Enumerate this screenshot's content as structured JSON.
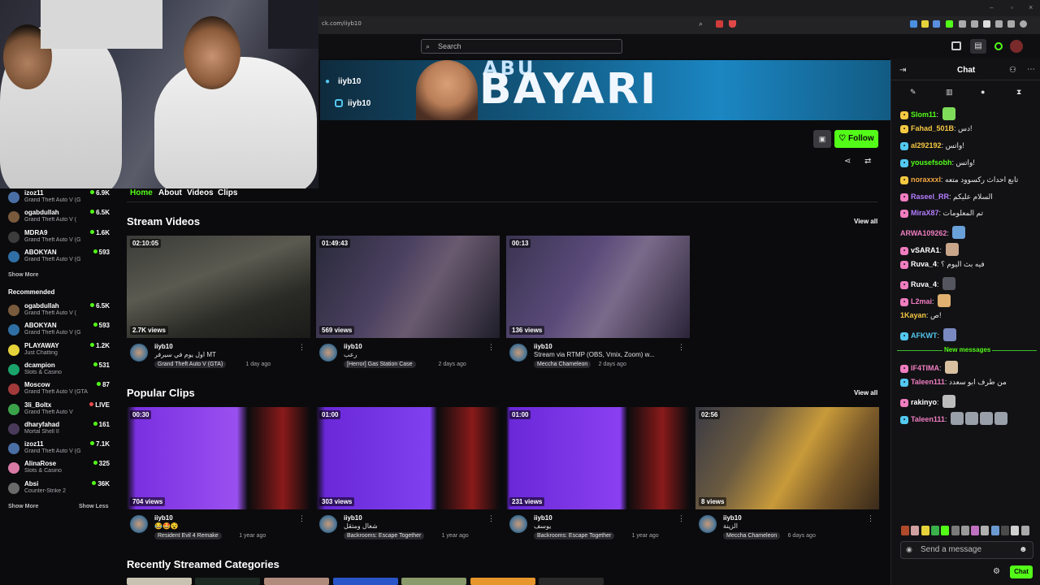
{
  "browser": {
    "url": "ck.com/iiyb10"
  },
  "search": {
    "placeholder": "Search"
  },
  "banner": {
    "top_text": "ABU",
    "title": "BAYARI",
    "social1": "iiyb10",
    "social2": "iiyb10"
  },
  "channel": {
    "follow_label": "Follow"
  },
  "sidebar": {
    "following": [
      {
        "name": "izoz11",
        "category": "Grand Theft Auto V (G",
        "count": "6.9K",
        "color": "#4a6fa5"
      },
      {
        "name": "ogabdullah",
        "category": "Grand Theft Auto V (",
        "count": "6.5K",
        "color": "#7a5a3c"
      },
      {
        "name": "MDRA9",
        "category": "Grand Theft Auto V (G",
        "count": "1.6K",
        "color": "#3c3c3c"
      },
      {
        "name": "ABOKYAN",
        "category": "Grand Theft Auto V (G",
        "count": "593",
        "color": "#2f6fa5"
      }
    ],
    "show_more": "Show More",
    "recommended_label": "Recommended",
    "recommended": [
      {
        "name": "ogabdullah",
        "category": "Grand Theft Auto V (",
        "count": "6.5K",
        "color": "#7a5a3c"
      },
      {
        "name": "ABOKYAN",
        "category": "Grand Theft Auto V (G",
        "count": "593",
        "color": "#2f6fa5"
      },
      {
        "name": "PLAYAWAY",
        "category": "Just Chatting",
        "count": "1.2K",
        "color": "#e6d23a"
      },
      {
        "name": "dcampion",
        "category": "Slots & Casino",
        "count": "531",
        "color": "#1aa36a"
      },
      {
        "name": "Moscow",
        "category": "Grand Theft Auto V (GTA)",
        "count": "87",
        "color": "#a33a3a"
      },
      {
        "name": "3li_Boltx",
        "category": "Grand Theft Auto V",
        "count": "LIVE",
        "color": "#3aa34a"
      },
      {
        "name": "dharyfahad",
        "category": "Mortal Shell II",
        "count": "161",
        "color": "#4a3a5a"
      },
      {
        "name": "izoz11",
        "category": "Grand Theft Auto V (G",
        "count": "7.1K",
        "color": "#4a6fa5"
      },
      {
        "name": "AlinaRose",
        "category": "Slots & Casino",
        "count": "325",
        "color": "#d97aa5"
      },
      {
        "name": "Absi",
        "category": "Counter-Strike 2",
        "count": "36K",
        "color": "#6a6a6a"
      }
    ],
    "show_more2": "Show More",
    "show_less": "Show Less"
  },
  "tabs": [
    "Home",
    "About",
    "Videos",
    "Clips"
  ],
  "stream_videos": {
    "title": "Stream Videos",
    "view_all": "View all",
    "items": [
      {
        "duration": "02:10:05",
        "views": "2.7K views",
        "channel": "iiyb10",
        "title": "اول يوم في سيرفر MT",
        "category": "Grand Theft Auto V (GTA)",
        "age": "1 day ago"
      },
      {
        "duration": "01:49:43",
        "views": "569 views",
        "channel": "iiyb10",
        "title": "رعب",
        "category": "[Herror] Gas Station Case",
        "age": "2 days ago"
      },
      {
        "duration": "00:13",
        "views": "136 views",
        "channel": "iiyb10",
        "title": "Stream via RTMP (OBS, Vmix, Zoom) w...",
        "category": "Meccha Chameleon",
        "age": "2 days ago"
      }
    ]
  },
  "popular_clips": {
    "title": "Popular Clips",
    "view_all": "View all",
    "items": [
      {
        "duration": "00:30",
        "views": "704 views",
        "channel": "iiyb10",
        "title": "😂🤩😵",
        "category": "Resident Evil 4 Remake",
        "age": "1 year ago"
      },
      {
        "duration": "01:00",
        "views": "303 views",
        "channel": "iiyb10",
        "title": "شغال ومتقل",
        "category": "Backrooms: Escape Together",
        "age": "1 year ago"
      },
      {
        "duration": "01:00",
        "views": "231 views",
        "channel": "iiyb10",
        "title": "يوسف",
        "category": "Backrooms: Escape Together",
        "age": "1 year ago"
      },
      {
        "duration": "02:56",
        "views": "8 views",
        "channel": "iiyb10",
        "title": "الزينة",
        "category": "Meccha Chameleon",
        "age": "6 days ago"
      }
    ]
  },
  "recent_categories": {
    "title": "Recently Streamed Categories"
  },
  "chat": {
    "title": "Chat",
    "new_messages": "New messages",
    "input_placeholder": "Send a message",
    "send_label": "Chat",
    "messages": [
      {
        "user": "Slom11",
        "text": "",
        "color": "#53fc18",
        "badge": "#f5c842",
        "emote": "#7fdc5a"
      },
      {
        "user": "Fahad_501B",
        "text": "دس!",
        "color": "#f5c842",
        "badge": "#f5c842",
        "emote": ""
      },
      {
        "user": "al292192",
        "text": "واتس!",
        "color": "#f5c842",
        "badge": "#53c8f0",
        "emote": ""
      },
      {
        "user": "yousefsobh",
        "text": "واتس!",
        "color": "#53fc18",
        "badge": "#53c8f0",
        "emote": ""
      },
      {
        "user": "noraxxxl",
        "text": "تابع احداث ركسوود متعه",
        "color": "#f5a742",
        "badge": "#f5c842",
        "emote": ""
      },
      {
        "user": "Raseel_RR",
        "text": "السلام عليكم",
        "color": "#b47dff",
        "badge": "#f07dc0",
        "emote": ""
      },
      {
        "user": "MiraX87",
        "text": "تم المعلومات",
        "color": "#b47dff",
        "badge": "#f07dc0",
        "emote": ""
      },
      {
        "user": "ARWA109262",
        "text": "",
        "color": "#f07dc0",
        "badge": "",
        "emote": "#6aa0d8"
      },
      {
        "user": "vSARA1",
        "text": "",
        "color": "#ffffff",
        "badge": "#f07dc0",
        "emote": "#c9a58a"
      },
      {
        "user": "Ruva_4",
        "text": "فيه بث اليوم ؟",
        "color": "#ffffff",
        "badge": "#f07dc0",
        "emote": ""
      },
      {
        "user": "Ruva_4",
        "text": "",
        "color": "#ffffff",
        "badge": "#f07dc0",
        "emote": "#555560"
      },
      {
        "user": "L2mai",
        "text": "",
        "color": "#f07dc0",
        "badge": "#f07dc0",
        "emote": "#e0b070"
      },
      {
        "user": "1Kayan",
        "text": "ص!",
        "color": "#f5c842",
        "badge": "",
        "emote": ""
      },
      {
        "user": "AFKWT",
        "text": "",
        "color": "#53c8f0",
        "badge": "#53c8f0",
        "emote": "#7a8ac0"
      },
      {
        "user": "IF4TIMA",
        "text": "",
        "color": "#f07dc0",
        "badge": "#f07dc0",
        "emote": "#d8c0a0"
      },
      {
        "user": "Taleen111",
        "text": "من طرف ابو سعدد",
        "color": "#f07dc0",
        "badge": "#53c8f0",
        "emote": ""
      },
      {
        "user": "rakinyo",
        "text": "",
        "color": "#ffffff",
        "badge": "#f07dc0",
        "emote": "#bcbcbc"
      },
      {
        "user": "Taleen111",
        "text": "",
        "color": "#f07dc0",
        "badge": "#53c8f0",
        "emote": "#9aa0aa"
      }
    ]
  },
  "colors": {
    "accent": "#53fc18",
    "background": "#0b0b0d",
    "chat_bg": "#121215"
  }
}
